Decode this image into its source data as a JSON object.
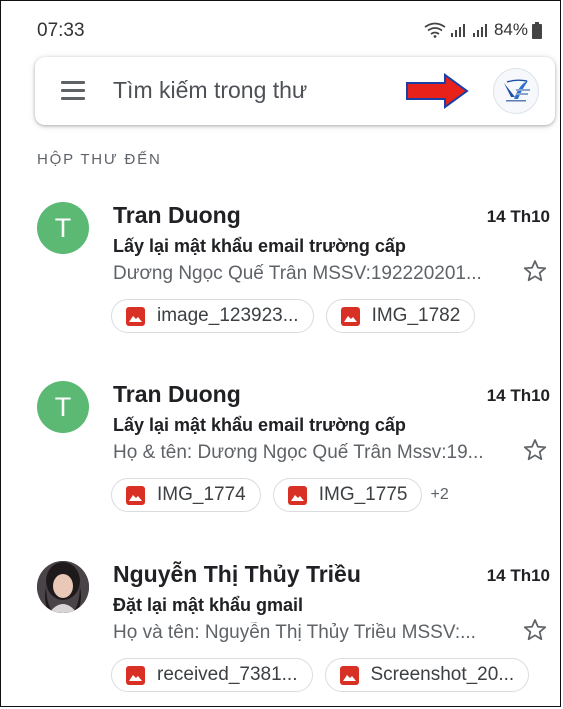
{
  "status_bar": {
    "time": "07:33",
    "battery": "84%"
  },
  "search": {
    "placeholder": "Tìm kiếm trong thư"
  },
  "section": {
    "label": "HỘP THƯ ĐẾN"
  },
  "messages": [
    {
      "avatar_letter": "T",
      "sender": "Tran Duong",
      "date": "14 Th10",
      "subject": "Lấy lại mật khẩu email trường cấp",
      "snippet": "Dương Ngọc Quế Trân MSSV:192220201...",
      "attachments": [
        "image_123923...",
        "IMG_1782"
      ]
    },
    {
      "avatar_letter": "T",
      "sender": "Tran Duong",
      "date": "14 Th10",
      "subject": "Lấy lại mật khẩu email trường cấp",
      "snippet": "Họ & tên: Dương Ngọc Quế Trân Mssv:19...",
      "attachments": [
        "IMG_1774",
        "IMG_1775"
      ],
      "more_count": "+2"
    },
    {
      "sender": "Nguyễn Thị Thủy Triều",
      "date": "14 Th10",
      "subject": "Đặt lại mật khẩu gmail",
      "snippet": "Họ và tên: Nguyễn Thị Thủy Triều MSSV:...",
      "attachments": [
        "received_7381...",
        "Screenshot_20..."
      ]
    }
  ],
  "icons": {
    "menu": "menu-icon",
    "arrow": "red-arrow-icon",
    "star": "star-icon",
    "attachment": "image-attachment-icon",
    "wifi": "wifi-icon",
    "signal": "signal-icon",
    "battery": "battery-icon"
  },
  "colors": {
    "avatar_green": "#5bb974",
    "attachment_red": "#d93025",
    "arrow_red": "#e8211a",
    "arrow_outline": "#1a3fa6"
  }
}
